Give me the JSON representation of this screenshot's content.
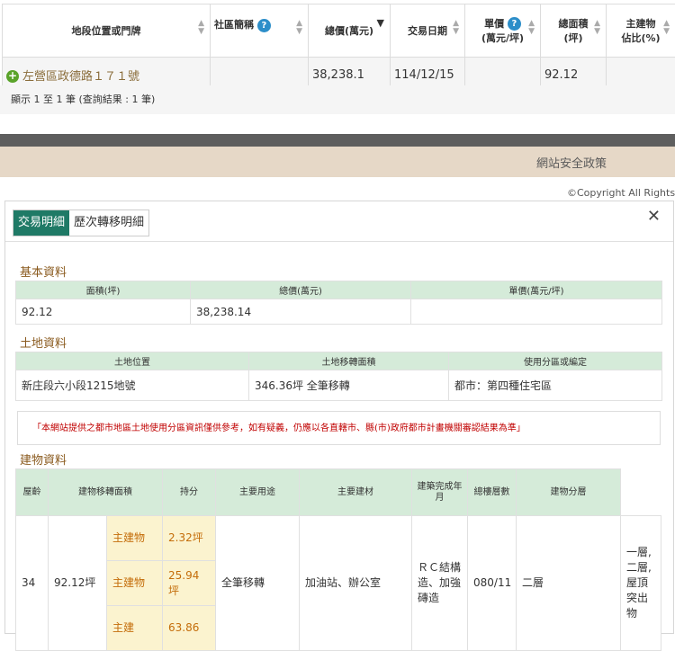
{
  "results": {
    "headers": {
      "location": "地段位置或門牌",
      "community": "社區簡稱",
      "total_price": "總價(萬元)",
      "trade_date": "交易日期",
      "unit_price_line1": "單價",
      "unit_price_line2": "(萬元/坪)",
      "area_line1": "總面積",
      "area_line2": "(坪)",
      "main_ratio_line1": "主建物",
      "main_ratio_line2": "佔比(%)"
    },
    "row": {
      "location": "左營區政德路１７１號",
      "community": "",
      "total_price": "38,238.1",
      "trade_date": "114/12/15",
      "unit_price": "",
      "area": "92.12",
      "main_ratio": ""
    },
    "pager": "顯示 1 至 1 筆 (查詢結果 : 1 筆)",
    "help_glyph": "?",
    "add_glyph": "+"
  },
  "footer": {
    "policy_link": "網站安全政策",
    "copyright": "©Copyright All Rights"
  },
  "modal": {
    "tabs": [
      "交易明細",
      "歷次轉移明細"
    ],
    "close_glyph": "✕",
    "basic": {
      "title": "基本資料",
      "headers": [
        "面積(坪)",
        "總價(萬元)",
        "單價(萬元/坪)"
      ],
      "values": [
        "92.12",
        "38,238.14",
        ""
      ]
    },
    "land": {
      "title": "土地資料",
      "headers": [
        "土地位置",
        "土地移轉面積",
        "使用分區或編定"
      ],
      "values": [
        "新庄段六小段1215地號",
        "346.36坪 全筆移轉",
        "都市：第四種住宅區"
      ]
    },
    "notice": "「本網站提供之都市地區土地使用分區資訊僅供參考，如有疑義，仍應以各直轄市、縣(市)政府都市計畫機關審認結果為準」",
    "building": {
      "title": "建物資料",
      "headers": {
        "age": "屋齡",
        "transfer_area": "建物移轉面積",
        "share": "持分",
        "main_use": "主要用途",
        "material": "主要建材",
        "built_year": "建築完成年月",
        "total_floors": "總樓層數",
        "floor": "建物分層"
      },
      "row": {
        "age": "34",
        "total_area": "92.12坪",
        "parts": [
          {
            "label": "主建物",
            "value": "2.32坪"
          },
          {
            "label": "主建物",
            "value": "25.94坪"
          },
          {
            "label": "主建",
            "value": "63.86"
          }
        ],
        "share": "全筆移轉",
        "main_use": "加油站、辦公室",
        "material": "ＲＣ結構造、加強磚造",
        "built_year": "080/11",
        "total_floors": "二層",
        "floor": "一層,二層,屋頂突出物"
      }
    }
  }
}
